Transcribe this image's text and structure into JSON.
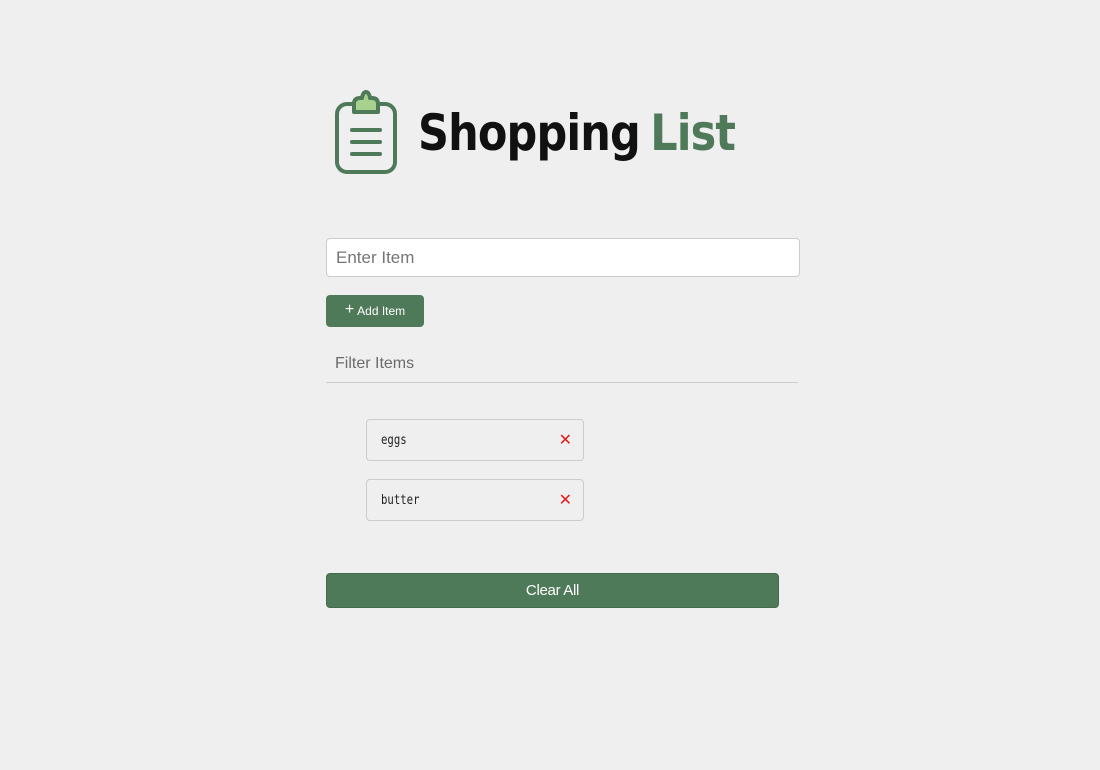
{
  "header": {
    "title_main": "Shopping",
    "title_accent": "List",
    "icon": "clipboard-icon"
  },
  "form": {
    "item_placeholder": "Enter Item",
    "item_value": "",
    "add_button": {
      "icon": "plus-icon",
      "icon_glyph": "+",
      "label": "Add Item"
    }
  },
  "filter": {
    "placeholder": "Filter Items",
    "value": ""
  },
  "items": [
    {
      "label": "eggs",
      "remove_glyph": "✕"
    },
    {
      "label": "butter",
      "remove_glyph": "✕"
    }
  ],
  "clear_button": {
    "label": "Clear All"
  },
  "colors": {
    "background": "#efefef",
    "accent": "#4f7a5a",
    "remove": "#e31b1b",
    "icon_light": "#a9d18e"
  }
}
